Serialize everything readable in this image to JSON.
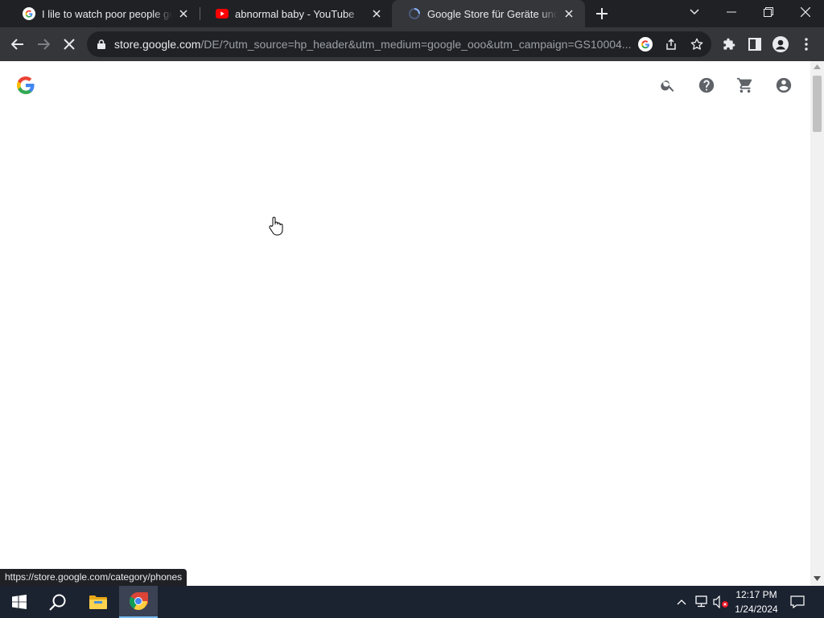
{
  "browser": {
    "tabs": [
      {
        "title": "I lile to watch poor people get rich",
        "favicon": "google-g-icon",
        "active": false
      },
      {
        "title": "abnormal baby - YouTube",
        "favicon": "youtube-icon",
        "active": false
      },
      {
        "title": "Google Store für Geräte und Zubehör",
        "favicon": "loading-spinner-icon",
        "active": true
      }
    ],
    "url_host": "store.google.com",
    "url_path": "/DE/?utm_source=hp_header&utm_medium=google_ooo&utm_campaign=GS10004..."
  },
  "page": {
    "header_icons": [
      "search-icon",
      "help-icon",
      "cart-icon",
      "account-circle-icon"
    ]
  },
  "status_bar": {
    "link": "https://store.google.com/category/phones"
  },
  "taskbar": {
    "time": "12:17 PM",
    "date": "1/24/2024"
  },
  "colors": {
    "tab_strip": "#202124",
    "toolbar": "#35363a",
    "taskbar": "#1b2230",
    "youtube_red": "#ff0000",
    "google_blue": "#4285f4",
    "google_red": "#ea4335",
    "google_yellow": "#fbbc05",
    "google_green": "#34a853"
  }
}
